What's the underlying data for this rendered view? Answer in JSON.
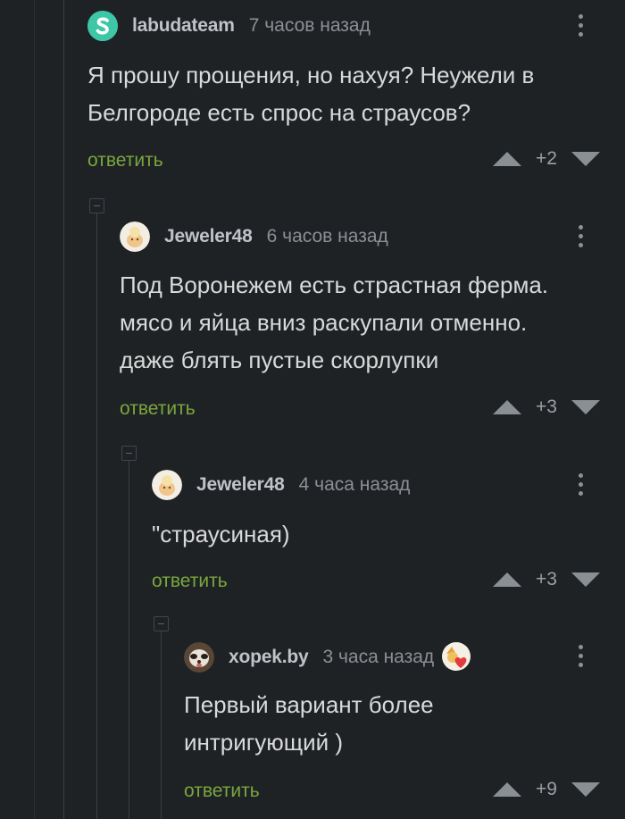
{
  "comments": [
    {
      "username": "labudateam",
      "time": "7 часов назад",
      "text": "Я прошу прощения, но нахуя? Неужели в\nБелгороде есть спрос на страусов?",
      "reply": "ответить",
      "score": "+2"
    },
    {
      "username": "Jeweler48",
      "time": "6 часов назад",
      "text": "Под Воронежем есть страстная ферма.\nмясо и яйца вниз раскупали отменно.\nдаже блять пустые скорлупки",
      "reply": "ответить",
      "score": "+3"
    },
    {
      "username": "Jeweler48",
      "time": "4 часа назад",
      "text": "\"страусиная)",
      "reply": "ответить",
      "score": "+3"
    },
    {
      "username": "xopek.by",
      "time": "3 часа назад",
      "text": "Первый вариант более\nинтригующий )",
      "reply": "ответить",
      "score": "+9"
    }
  ],
  "colors": {
    "background": "#1f2225",
    "reply_link": "#7aa63d",
    "text": "#d9d9d9"
  }
}
